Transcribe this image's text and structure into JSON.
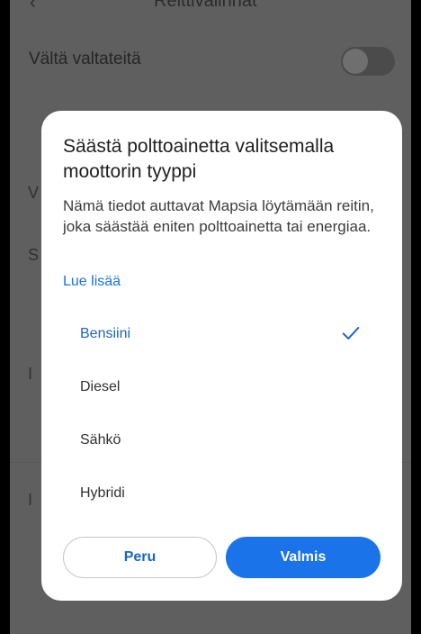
{
  "background": {
    "title": "Reittivalinnat",
    "avoid_highways_label": "Vältä valtateitä",
    "avoid_highways_on": false
  },
  "dialog": {
    "title": "Säästä polttoainetta valitsemalla moottorin tyyppi",
    "body": "Nämä tiedot auttavat Mapsia löytämään reitin, joka säästää eniten polttoainetta tai energiaa.",
    "learn_more": "Lue lisää",
    "options": [
      {
        "label": "Bensiini",
        "selected": true
      },
      {
        "label": "Diesel",
        "selected": false
      },
      {
        "label": "Sähkö",
        "selected": false
      },
      {
        "label": "Hybridi",
        "selected": false
      }
    ],
    "cancel_label": "Peru",
    "done_label": "Valmis"
  },
  "colors": {
    "accent": "#1a73e8",
    "selected_text": "#1a66c4",
    "scrim": "#5f5f5f"
  },
  "icons": {
    "back": "back-arrow-icon",
    "check": "check-icon"
  }
}
